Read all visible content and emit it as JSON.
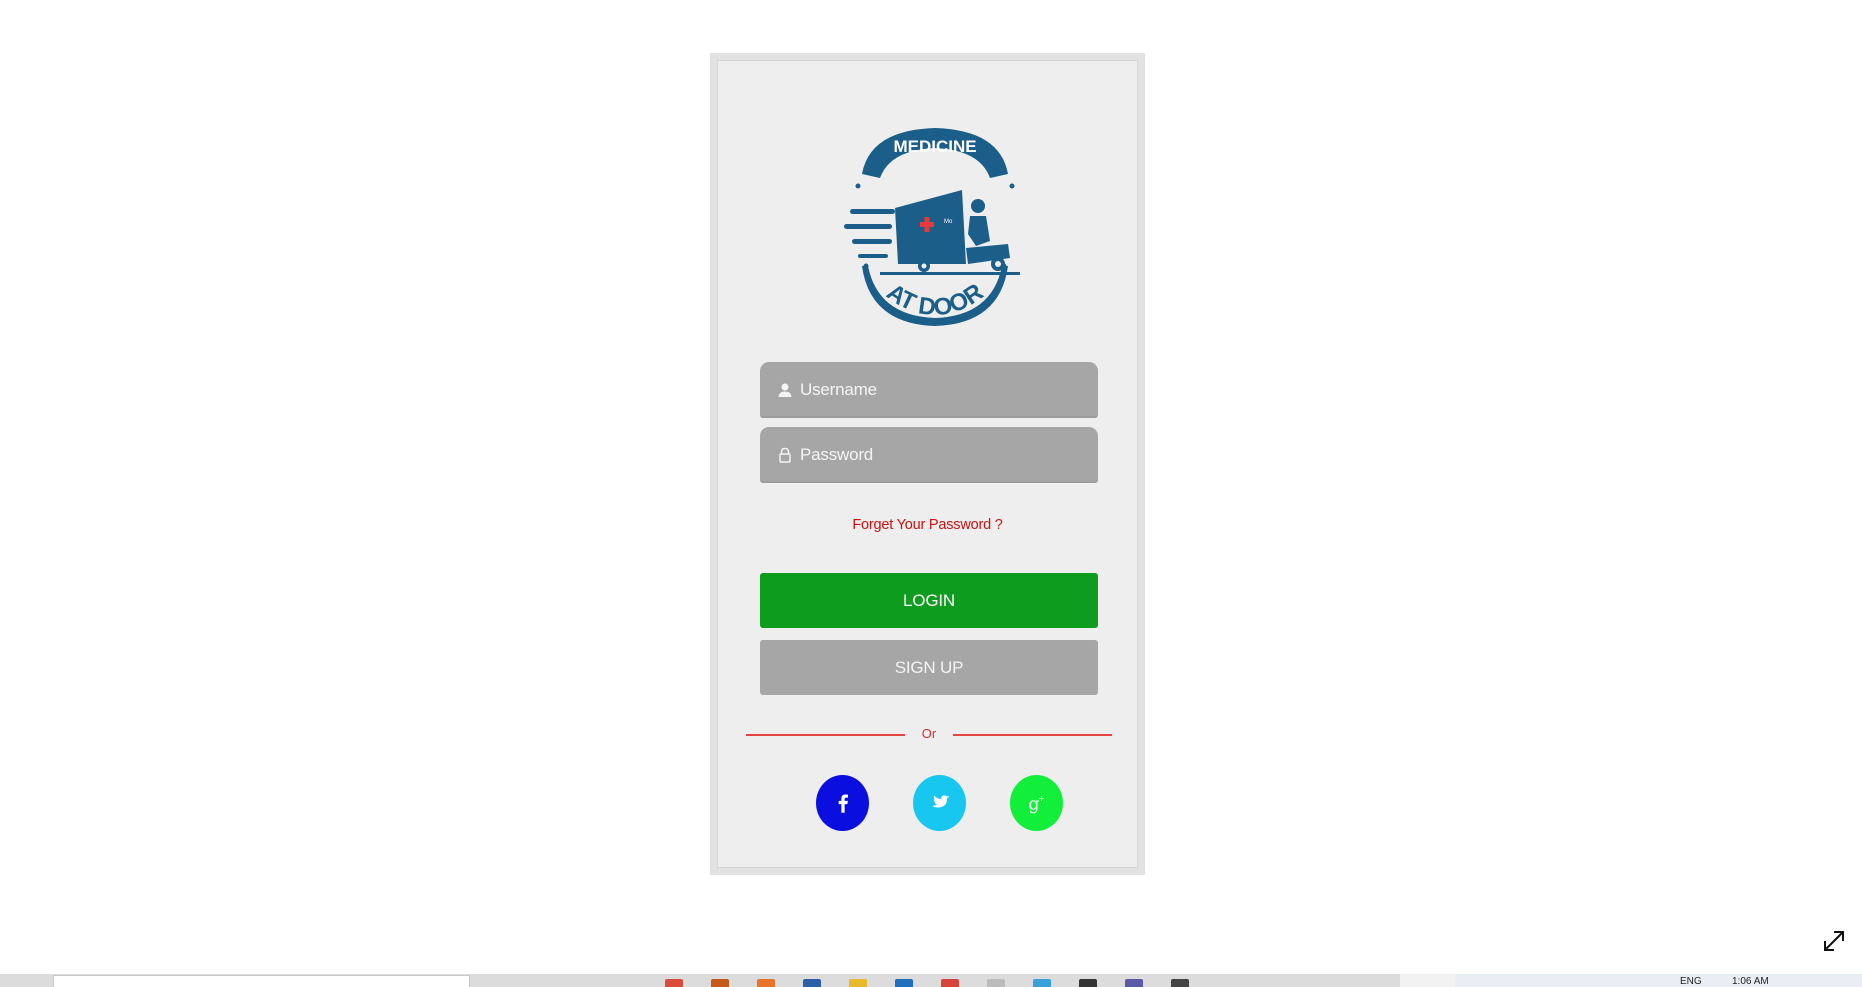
{
  "logo": {
    "top_text": "MEDICINE",
    "bottom_text": "AT DOOR",
    "van_label": "Mo",
    "brand_color": "#1b5e89"
  },
  "login_form": {
    "username_placeholder": "Username",
    "password_placeholder": "Password",
    "forgot_link": "Forget Your Password ?",
    "login_button": "LOGIN",
    "signup_button": "SIGN UP",
    "divider_text": "Or"
  },
  "social": [
    {
      "name": "facebook",
      "icon": "facebook-icon",
      "color": "#0a0fe0"
    },
    {
      "name": "twitter",
      "icon": "twitter-icon",
      "color": "#18c7ef"
    },
    {
      "name": "google-plus",
      "icon": "google-plus-icon",
      "color": "#12ef3a"
    }
  ],
  "colors": {
    "login_green": "#0d9c1e",
    "field_gray": "#a6a6a6",
    "link_red": "#cc1111",
    "divider_red": "#e64545"
  },
  "taskbar": {
    "language": "ENG",
    "time": "1:06 AM"
  }
}
